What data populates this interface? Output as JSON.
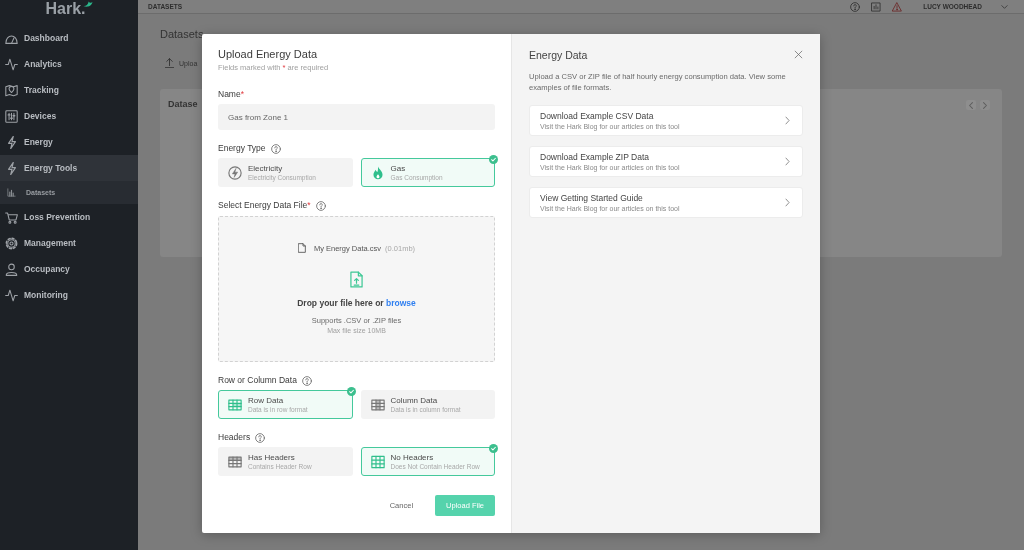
{
  "sidebar": {
    "logo": "Hark.",
    "items": [
      {
        "label": "Dashboard",
        "selected": false
      },
      {
        "label": "Analytics",
        "selected": false
      },
      {
        "label": "Tracking",
        "selected": false
      },
      {
        "label": "Devices",
        "selected": false
      },
      {
        "label": "Energy",
        "selected": false
      },
      {
        "label": "Energy Tools",
        "selected": true,
        "children": [
          {
            "label": "Datasets",
            "selected": true
          }
        ]
      },
      {
        "label": "Loss Prevention",
        "selected": false
      },
      {
        "label": "Management",
        "selected": false
      },
      {
        "label": "Occupancy",
        "selected": false
      },
      {
        "label": "Monitoring",
        "selected": false
      }
    ]
  },
  "header": {
    "title": "DATASETS",
    "user": "LUCY WOODHEAD"
  },
  "page": {
    "title": "Datasets",
    "upload_button": "Uploa",
    "card_title": "Datase"
  },
  "upload_form": {
    "title": "Upload Energy Data",
    "required_note": {
      "before": "Fields marked with",
      "mark": "*",
      "after": "are required"
    },
    "name_field": {
      "label": "Name",
      "required_mark": "*",
      "value": "Gas from Zone 1"
    },
    "energy_type": {
      "label": "Energy Type",
      "options": [
        {
          "title": "Electricity",
          "subtitle": "Electricity Consumption",
          "selected": false
        },
        {
          "title": "Gas",
          "subtitle": "Gas Consumption",
          "selected": true
        }
      ]
    },
    "file_field": {
      "label": "Select Energy Data File",
      "required_mark": "*",
      "file_name": "My Energy Data.csv",
      "file_size": "(0.01mb)",
      "drop_text": "Drop your file here or",
      "browse_link": "browse",
      "supported": "Supports .CSV or .ZIP files",
      "max_size": "Max file size 10MB"
    },
    "data_layout": {
      "label": "Row or Column Data",
      "options": [
        {
          "title": "Row Data",
          "subtitle": "Data is in row format",
          "selected": true
        },
        {
          "title": "Column Data",
          "subtitle": "Data is in column format",
          "selected": false
        }
      ]
    },
    "headers": {
      "label": "Headers",
      "options": [
        {
          "title": "Has Headers",
          "subtitle": "Contains Header Row",
          "selected": false
        },
        {
          "title": "No Headers",
          "subtitle": "Does Not Contain Header Row",
          "selected": true
        }
      ]
    },
    "actions": {
      "cancel": "Cancel",
      "submit": "Upload File"
    }
  },
  "help_panel": {
    "title": "Energy Data",
    "description": "Upload a CSV or ZIP file of half hourly energy consumption data. View some examples of file formats.",
    "links": [
      {
        "title": "Download Example CSV Data",
        "subtitle": "Visit the Hark Blog for our articles on this tool"
      },
      {
        "title": "Download Example ZIP Data",
        "subtitle": "Visit the Hark Blog for our articles on this tool"
      },
      {
        "title": "View Getting Started Guide",
        "subtitle": "Visit the Hark Blog for our articles on this tool"
      }
    ]
  }
}
